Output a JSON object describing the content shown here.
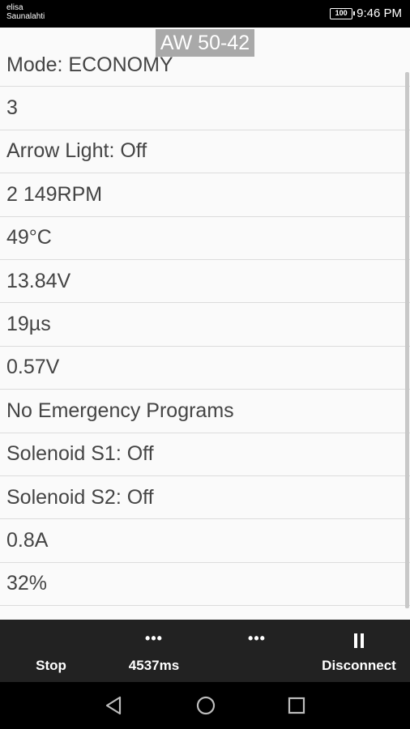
{
  "status_bar": {
    "carrier_line1": "elisa",
    "carrier_line2": "Saunalahti",
    "battery": "100",
    "time": "9:46 PM"
  },
  "header": {
    "title": "AW 50-42"
  },
  "items": [
    {
      "text": "Mode: ECONOMY"
    },
    {
      "text": "3"
    },
    {
      "text": "Arrow Light: Off"
    },
    {
      "text": "2 149RPM"
    },
    {
      "text": "49°C"
    },
    {
      "text": "13.84V"
    },
    {
      "text": "19µs"
    },
    {
      "text": "0.57V"
    },
    {
      "text": "No Emergency Programs"
    },
    {
      "text": "Solenoid S1: Off"
    },
    {
      "text": "Solenoid S2: Off"
    },
    {
      "text": "0.8A"
    },
    {
      "text": "32%"
    }
  ],
  "action_bar": {
    "stop_label": "Stop",
    "timing_label": "4537ms",
    "disconnect_label": "Disconnect"
  },
  "icons": {
    "more": "more-horizontal-icon",
    "pause": "pause-icon",
    "back": "nav-back-icon",
    "home": "nav-home-icon",
    "recents": "nav-recents-icon"
  },
  "colors": {
    "list_background": "#fafafa",
    "row_text": "#444444",
    "title_badge": "#a9a9a9",
    "action_bar": "#222222"
  }
}
